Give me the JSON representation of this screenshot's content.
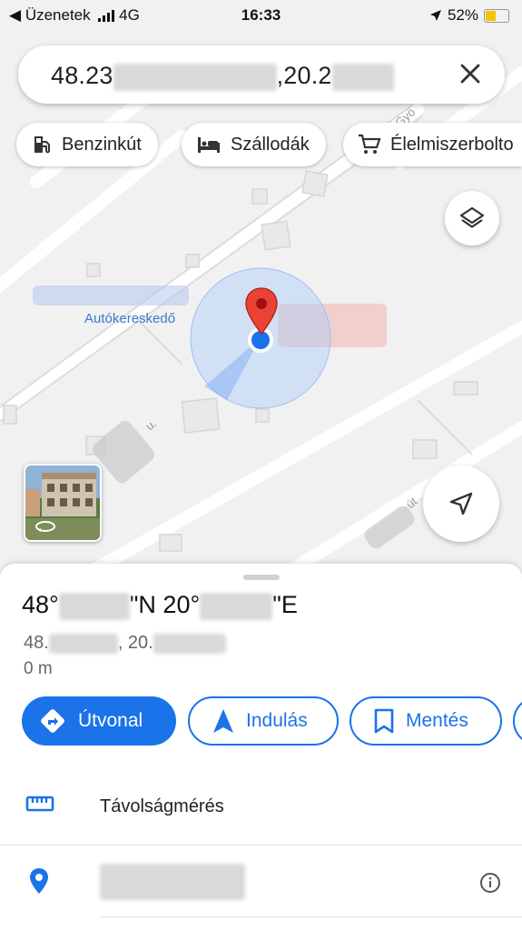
{
  "status_bar": {
    "back_label": "Üzenetek",
    "network": "4G",
    "time": "16:33",
    "battery_percent": "52%",
    "battery_level": 0.52
  },
  "search": {
    "query_prefix": "48.23",
    "query_middle": ",20.2"
  },
  "chips": [
    {
      "label": "Benzinkút",
      "icon": "gas-station-icon"
    },
    {
      "label": "Szállodák",
      "icon": "hotel-bed-icon"
    },
    {
      "label": "Élelmiszerbolto",
      "icon": "shopping-cart-icon"
    }
  ],
  "map": {
    "place_label": "Autókereskedő"
  },
  "place": {
    "coords_deg": "48°",
    "coords_n": "\"N 20°",
    "coords_e": "\"E",
    "decimal_prefix": "48.",
    "decimal_middle": ", 20.",
    "distance": "0 m"
  },
  "actions": {
    "directions": "Útvonal",
    "start": "Indulás",
    "save": "Mentés"
  },
  "list": {
    "measure": "Távolságmérés"
  },
  "colors": {
    "accent": "#1a73e8",
    "pin": "#ea4335"
  }
}
